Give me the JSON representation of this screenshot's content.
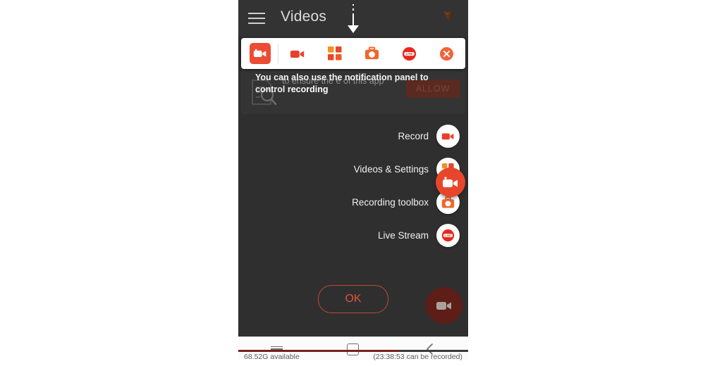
{
  "app": {
    "header": {
      "title": "Videos",
      "menu_icon": "hamburger-icon",
      "premium_icon": "gem-icon"
    },
    "toolbar": {
      "items": [
        {
          "name": "app-record-tile",
          "icon": "video-camera-tile-icon",
          "label": ""
        },
        {
          "name": "record",
          "icon": "video-camera-icon",
          "label": ""
        },
        {
          "name": "videos-settings",
          "icon": "grid-icon",
          "label": ""
        },
        {
          "name": "recording-toolbox",
          "icon": "toolbox-icon",
          "label": ""
        },
        {
          "name": "live-stream",
          "icon": "live-badge-icon",
          "label": "LIVE"
        },
        {
          "name": "close",
          "icon": "close-circle-icon",
          "label": ""
        }
      ]
    },
    "permission_dialog": {
      "icon": "document-search-icon",
      "body": "to ensure the    e of this app",
      "allow_label": "ALLOW"
    },
    "coach_mark": {
      "text_before": "You can also use the notification panel to control ",
      "highlight": "recording",
      "arrow_icon": "down-arrow-icon",
      "ok_label": "OK"
    },
    "menu": {
      "items": [
        {
          "label": "Record",
          "icon": "video-camera-icon"
        },
        {
          "label": "Videos & Settings",
          "icon": "grid-icon"
        },
        {
          "label": "Recording toolbox",
          "icon": "toolbox-icon"
        },
        {
          "label": "Live Stream",
          "icon": "live-badge-icon"
        }
      ]
    },
    "fab": {
      "expanded_icon": "video-camera-icon",
      "background_icon": "video-camera-icon"
    },
    "storage": {
      "available": "68.52G available",
      "recordable": "(23:38:53 can be recorded)",
      "progress_percent": 70
    }
  },
  "system_nav": {
    "recents_icon": "recents-icon",
    "home_icon": "home-icon",
    "back_icon": "back-chevron-icon"
  },
  "colors": {
    "accent": "#ea4c34",
    "live_red": "#e8291f",
    "orange": "#f07a22",
    "dark_bg": "#2f2f2f",
    "header_bg": "#333333"
  }
}
